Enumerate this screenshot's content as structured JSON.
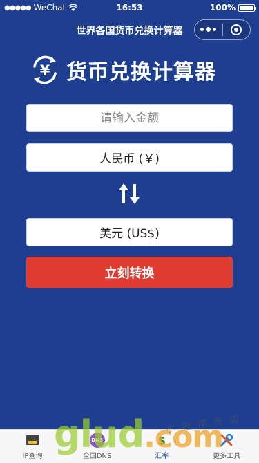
{
  "status_bar": {
    "carrier": "WeChat",
    "time": "16:53",
    "battery": "100%",
    "battery_level": 1.0
  },
  "nav": {
    "title": "世界各国货币兑换计算器"
  },
  "logo": {
    "symbol": "¥",
    "title": "货币兑换计算器"
  },
  "form": {
    "amount_placeholder": "请输入金额",
    "amount_value": "",
    "from_currency": "人民币 (￥)",
    "swap_icon": "swap-arrows-icon",
    "to_currency": "美元 (US$)",
    "convert_label": "立刻转换"
  },
  "tabbar": {
    "items": [
      {
        "label": "IP查询",
        "icon": "chip-icon"
      },
      {
        "label": "全国DNS",
        "icon": "dns-icon",
        "icon_text": "DNS"
      },
      {
        "label": "汇率",
        "icon": "currency-rate-icon",
        "icon_text": "$"
      },
      {
        "label": "更多工具",
        "icon": "tools-icon"
      }
    ],
    "active_index": 2
  },
  "watermark": {
    "text": "glud",
    "suffix": ".com",
    "sub": "小 程 序 商 店"
  },
  "colors": {
    "background": "#1e3f8f",
    "button": "#e03c31",
    "field": "#ffffff"
  }
}
